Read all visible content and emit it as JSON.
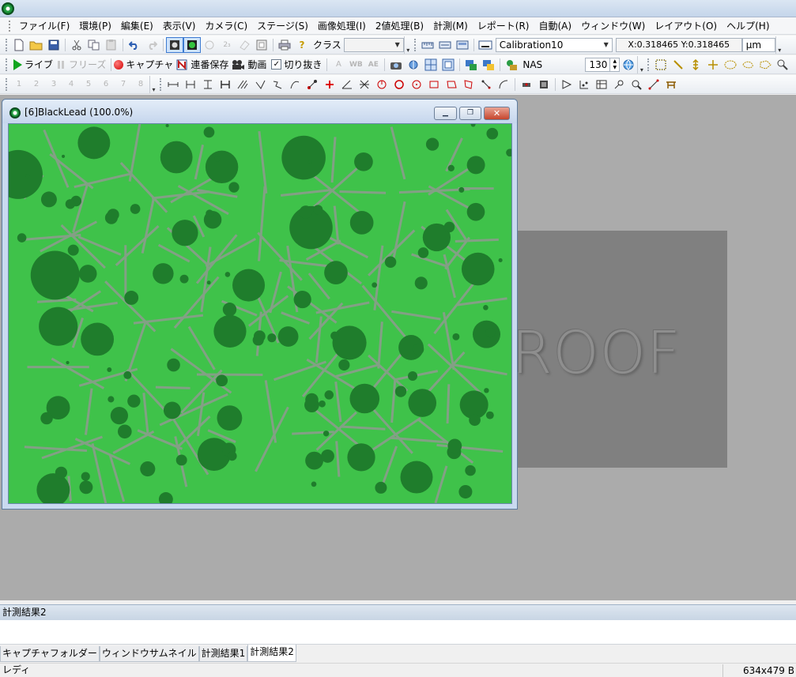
{
  "menubar": {
    "items": [
      "ファイル(F)",
      "環境(P)",
      "編集(E)",
      "表示(V)",
      "カメラ(C)",
      "ステージ(S)",
      "画像処理(I)",
      "2値処理(B)",
      "計測(M)",
      "レポート(R)",
      "自動(A)",
      "ウィンドウ(W)",
      "レイアウト(O)",
      "ヘルプ(H)"
    ]
  },
  "toolbar1": {
    "class_label": "クラス",
    "class_value": "",
    "calibration_value": "Calibration10",
    "coordinates": "X:0.318465 Y:0.318465",
    "unit": "μm"
  },
  "toolbar2": {
    "live_label": "ライブ",
    "freeze_label": "フリーズ",
    "capture_label": "キャプチャ",
    "serial_save_label": "連番保存",
    "movie_label": "動画",
    "crop_label": "切り抜き",
    "crop_checked": "✓",
    "nas_label": "NAS",
    "spin_value": "130"
  },
  "toolbar3": {
    "layer_labels": [
      "1",
      "2",
      "3",
      "4",
      "5",
      "6",
      "7",
      "8"
    ]
  },
  "child_window": {
    "title": "[6]BlackLead (100.0%)"
  },
  "watermark": {
    "text": "ROOF"
  },
  "results_panel": {
    "title": "計測結果2"
  },
  "bottom_tabs": [
    "キャプチャフォルダー",
    "ウィンドウサムネイル",
    "計測結果1",
    "計測結果2"
  ],
  "statusbar": {
    "left_text": "レディ",
    "image_size": "634x479 B"
  },
  "colors": {
    "image_background": "#3fc24a",
    "nodule_color": "#1f7d2c",
    "grain_boundary": "#8f9b90",
    "workspace": "#ababab"
  }
}
